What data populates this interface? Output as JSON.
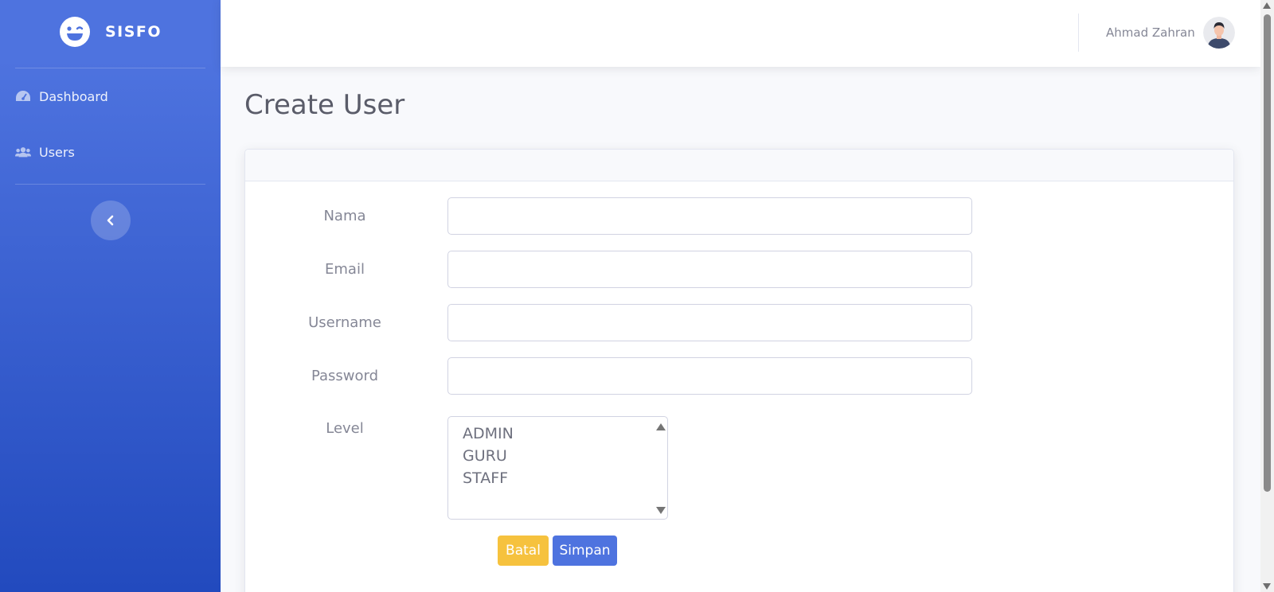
{
  "brand": {
    "name": "SISFO",
    "logo_icon": "laugh-wink-icon"
  },
  "sidebar": {
    "items": [
      {
        "label": "Dashboard",
        "icon": "tachometer-icon"
      },
      {
        "label": "Users",
        "icon": "users-icon"
      }
    ],
    "toggle_icon": "chevron-left-icon"
  },
  "topbar": {
    "user_name": "Ahmad Zahran",
    "avatar_icon": "user-avatar-icon"
  },
  "main": {
    "title": "Create User"
  },
  "form": {
    "fields": [
      {
        "label": "Nama",
        "value": "",
        "placeholder": ""
      },
      {
        "label": "Email",
        "value": "",
        "placeholder": ""
      },
      {
        "label": "Username",
        "value": "",
        "placeholder": ""
      },
      {
        "label": "Password",
        "value": "",
        "placeholder": ""
      }
    ],
    "level": {
      "label": "Level",
      "options": [
        "ADMIN",
        "GURU",
        "STAFF"
      ]
    },
    "cancel_label": "Batal",
    "submit_label": "Simpan"
  },
  "colors": {
    "primary": "#4e73df",
    "primary_dark": "#224abe",
    "warning": "#f6c23e",
    "text_muted": "#858796",
    "heading": "#5a5c69"
  }
}
